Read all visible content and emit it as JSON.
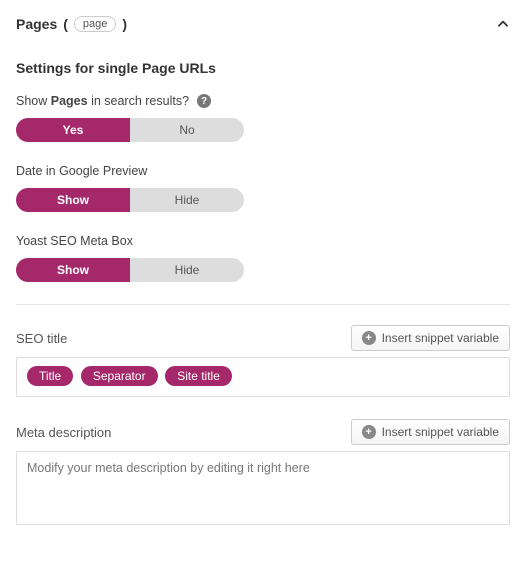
{
  "header": {
    "title": "Pages",
    "post_type_slug": "page"
  },
  "subheading": "Settings for single Page URLs",
  "settings": {
    "show_in_search": {
      "label_prefix": "Show ",
      "label_bold": "Pages",
      "label_suffix": " in search results?",
      "opt_active": "Yes",
      "opt_inactive": "No"
    },
    "date_preview": {
      "label": "Date in Google Preview",
      "opt_active": "Show",
      "opt_inactive": "Hide"
    },
    "meta_box": {
      "label": "Yoast SEO Meta Box",
      "opt_active": "Show",
      "opt_inactive": "Hide"
    }
  },
  "seo_title": {
    "label": "SEO title",
    "insert_label": "Insert snippet variable",
    "variables": [
      "Title",
      "Separator",
      "Site title"
    ]
  },
  "meta_description": {
    "label": "Meta description",
    "insert_label": "Insert snippet variable",
    "placeholder": "Modify your meta description by editing it right here"
  }
}
